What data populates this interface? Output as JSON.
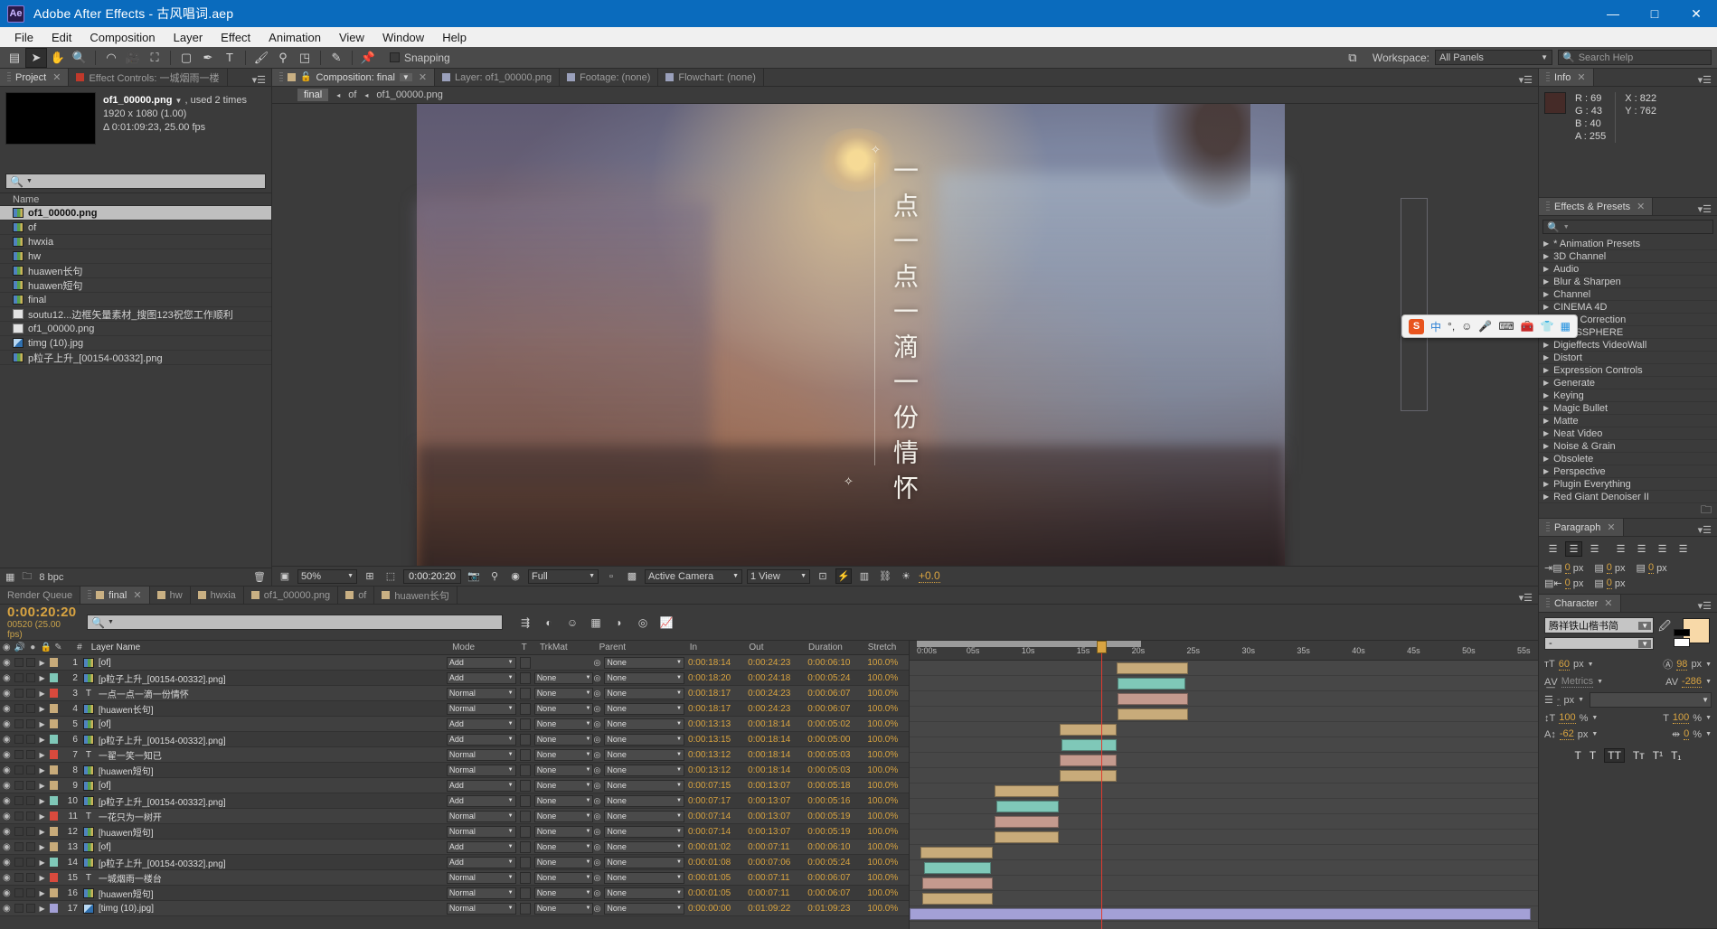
{
  "window": {
    "app_badge": "Ae",
    "title": "Adobe After Effects - 古风唱词.aep",
    "minimize": "—",
    "maximize": "□",
    "close": "✕"
  },
  "menu": [
    "File",
    "Edit",
    "Composition",
    "Layer",
    "Effect",
    "Animation",
    "View",
    "Window",
    "Help"
  ],
  "toolbar": {
    "snapping_label": "Snapping",
    "workspace_label": "Workspace:",
    "workspace_value": "All Panels",
    "search_help_placeholder": "Search Help",
    "tools": [
      "selection-tool",
      "hand-tool",
      "zoom-tool",
      "rotation-tool",
      "camera-tool",
      "pan-behind-tool",
      "shape-tool",
      "pen-tool",
      "type-tool",
      "brush-tool",
      "clone-stamp-tool",
      "eraser-tool",
      "roto-brush-tool",
      "puppet-pin-tool"
    ]
  },
  "project_panel": {
    "tabs": [
      {
        "label": "Project",
        "selected": true,
        "closable": true
      },
      {
        "label": "Effect Controls: 一城烟雨一楼",
        "selected": false,
        "closable": false
      }
    ],
    "preview": {
      "name": "of1_00000.png",
      "used": ", used 2 times",
      "dimensions": "1920 x 1080 (1.00)",
      "duration": "Δ 0:01:09:23, 25.00 fps"
    },
    "search_placeholder": "",
    "column_header": "Name",
    "items": [
      {
        "label": "of1_00000.png",
        "type": "comp",
        "selected": true
      },
      {
        "label": "of",
        "type": "comp",
        "selected": false
      },
      {
        "label": "hwxia",
        "type": "comp",
        "selected": false
      },
      {
        "label": "hw",
        "type": "comp",
        "selected": false
      },
      {
        "label": "huawen长句",
        "type": "comp",
        "selected": false
      },
      {
        "label": "huawen短句",
        "type": "comp",
        "selected": false
      },
      {
        "label": "final",
        "type": "comp",
        "selected": false
      },
      {
        "label": "soutu12...边框矢量素材_搜图123祝您工作顺利",
        "type": "doc",
        "selected": false
      },
      {
        "label": "of1_00000.png",
        "type": "doc",
        "selected": false
      },
      {
        "label": "timg (10).jpg",
        "type": "jpg",
        "selected": false
      },
      {
        "label": "p粒子上升_[00154-00332].png",
        "type": "seq",
        "selected": false
      }
    ],
    "footer_bpc": "8 bpc"
  },
  "composition_panel": {
    "tabs": [
      {
        "label": "Composition: final",
        "selected": true
      },
      {
        "label": "Layer: of1_00000.png",
        "selected": false
      },
      {
        "label": "Footage: (none)",
        "selected": false
      },
      {
        "label": "Flowchart: (none)",
        "selected": false
      }
    ],
    "breadcrumb": [
      "final",
      "of",
      "of1_00000.png"
    ],
    "canvas_text": "一点一点一滴一份情怀",
    "bottom_bar": {
      "zoom": "50%",
      "timecode": "0:00:20:20",
      "resolution": "Full",
      "view_mode": "Active Camera",
      "views": "1 View",
      "exposure": "+0.0"
    }
  },
  "timeline": {
    "tabs": [
      {
        "label": "Render Queue",
        "selected": false,
        "chip": false
      },
      {
        "label": "final",
        "selected": true,
        "chip": true
      },
      {
        "label": "hw",
        "selected": false,
        "chip": true
      },
      {
        "label": "hwxia",
        "selected": false,
        "chip": true
      },
      {
        "label": "of1_00000.png",
        "selected": false,
        "chip": true
      },
      {
        "label": "of",
        "selected": false,
        "chip": true
      },
      {
        "label": "huawen长句",
        "selected": false,
        "chip": true
      }
    ],
    "current_time": "0:00:20:20",
    "current_frame": "00520 (25.00 fps)",
    "search_placeholder": "",
    "columns": [
      "#",
      "Layer Name",
      "Mode",
      "T",
      "TrkMat",
      "Parent",
      "In",
      "Out",
      "Duration",
      "Stretch"
    ],
    "ruler_ticks": [
      "0:00s",
      "05s",
      "10s",
      "15s",
      "20s",
      "25s",
      "30s",
      "35s",
      "40s",
      "45s",
      "50s",
      "55s"
    ],
    "layers": [
      {
        "num": "1",
        "name": "[of]",
        "kind": "comp",
        "color": "#c8ab7a",
        "mode": "Add",
        "trkmat": "",
        "parent": "None",
        "in": "0:00:18:14",
        "out": "0:00:24:23",
        "duration": "0:00:06:10",
        "stretch": "100.0%",
        "bar_start": 0.332,
        "bar_width": 0.115,
        "bar_color": "#c8ab7a"
      },
      {
        "num": "2",
        "name": "[p粒子上升_[00154-00332].png]",
        "kind": "seq",
        "color": "#7fc8b8",
        "mode": "Add",
        "trkmat": "None",
        "parent": "None",
        "in": "0:00:18:20",
        "out": "0:00:24:18",
        "duration": "0:00:05:24",
        "stretch": "100.0%",
        "bar_start": 0.334,
        "bar_width": 0.108,
        "bar_color": "#7fc8b8"
      },
      {
        "num": "3",
        "name": "一点一点一滴一份情怀",
        "kind": "text",
        "color": "#d94a3d",
        "mode": "Normal",
        "trkmat": "None",
        "parent": "None",
        "in": "0:00:18:17",
        "out": "0:00:24:23",
        "duration": "0:00:06:07",
        "stretch": "100.0%",
        "bar_start": 0.333,
        "bar_width": 0.113,
        "bar_color": "#c49a8e"
      },
      {
        "num": "4",
        "name": "[huawen长句]",
        "kind": "comp",
        "color": "#c8ab7a",
        "mode": "Normal",
        "trkmat": "None",
        "parent": "None",
        "in": "0:00:18:17",
        "out": "0:00:24:23",
        "duration": "0:00:06:07",
        "stretch": "100.0%",
        "bar_start": 0.333,
        "bar_width": 0.113,
        "bar_color": "#c8ab7a"
      },
      {
        "num": "5",
        "name": "[of]",
        "kind": "comp",
        "color": "#c8ab7a",
        "mode": "Add",
        "trkmat": "None",
        "parent": "None",
        "in": "0:00:13:13",
        "out": "0:00:18:14",
        "duration": "0:00:05:02",
        "stretch": "100.0%",
        "bar_start": 0.24,
        "bar_width": 0.092,
        "bar_color": "#c8ab7a"
      },
      {
        "num": "6",
        "name": "[p粒子上升_[00154-00332].png]",
        "kind": "seq",
        "color": "#7fc8b8",
        "mode": "Add",
        "trkmat": "None",
        "parent": "None",
        "in": "0:00:13:15",
        "out": "0:00:18:14",
        "duration": "0:00:05:00",
        "stretch": "100.0%",
        "bar_start": 0.243,
        "bar_width": 0.089,
        "bar_color": "#7fc8b8"
      },
      {
        "num": "7",
        "name": "一翟一笑一知已",
        "kind": "text",
        "color": "#d94a3d",
        "mode": "Normal",
        "trkmat": "None",
        "parent": "None",
        "in": "0:00:13:12",
        "out": "0:00:18:14",
        "duration": "0:00:05:03",
        "stretch": "100.0%",
        "bar_start": 0.24,
        "bar_width": 0.092,
        "bar_color": "#c49a8e"
      },
      {
        "num": "8",
        "name": "[huawen短句]",
        "kind": "comp",
        "color": "#c8ab7a",
        "mode": "Normal",
        "trkmat": "None",
        "parent": "None",
        "in": "0:00:13:12",
        "out": "0:00:18:14",
        "duration": "0:00:05:03",
        "stretch": "100.0%",
        "bar_start": 0.24,
        "bar_width": 0.092,
        "bar_color": "#c8ab7a"
      },
      {
        "num": "9",
        "name": "[of]",
        "kind": "comp",
        "color": "#c8ab7a",
        "mode": "Add",
        "trkmat": "None",
        "parent": "None",
        "in": "0:00:07:15",
        "out": "0:00:13:07",
        "duration": "0:00:05:18",
        "stretch": "100.0%",
        "bar_start": 0.136,
        "bar_width": 0.103,
        "bar_color": "#c8ab7a"
      },
      {
        "num": "10",
        "name": "[p粒子上升_[00154-00332].png]",
        "kind": "seq",
        "color": "#7fc8b8",
        "mode": "Add",
        "trkmat": "None",
        "parent": "None",
        "in": "0:00:07:17",
        "out": "0:00:13:07",
        "duration": "0:00:05:16",
        "stretch": "100.0%",
        "bar_start": 0.139,
        "bar_width": 0.1,
        "bar_color": "#7fc8b8"
      },
      {
        "num": "11",
        "name": "一花只为一树开",
        "kind": "text",
        "color": "#d94a3d",
        "mode": "Normal",
        "trkmat": "None",
        "parent": "None",
        "in": "0:00:07:14",
        "out": "0:00:13:07",
        "duration": "0:00:05:19",
        "stretch": "100.0%",
        "bar_start": 0.136,
        "bar_width": 0.103,
        "bar_color": "#c49a8e"
      },
      {
        "num": "12",
        "name": "[huawen短句]",
        "kind": "comp",
        "color": "#c8ab7a",
        "mode": "Normal",
        "trkmat": "None",
        "parent": "None",
        "in": "0:00:07:14",
        "out": "0:00:13:07",
        "duration": "0:00:05:19",
        "stretch": "100.0%",
        "bar_start": 0.136,
        "bar_width": 0.103,
        "bar_color": "#c8ab7a"
      },
      {
        "num": "13",
        "name": "[of]",
        "kind": "comp",
        "color": "#c8ab7a",
        "mode": "Add",
        "trkmat": "None",
        "parent": "None",
        "in": "0:00:01:02",
        "out": "0:00:07:11",
        "duration": "0:00:06:10",
        "stretch": "100.0%",
        "bar_start": 0.018,
        "bar_width": 0.115,
        "bar_color": "#c8ab7a"
      },
      {
        "num": "14",
        "name": "[p粒子上升_[00154-00332].png]",
        "kind": "seq",
        "color": "#7fc8b8",
        "mode": "Add",
        "trkmat": "None",
        "parent": "None",
        "in": "0:00:01:08",
        "out": "0:00:07:06",
        "duration": "0:00:05:24",
        "stretch": "100.0%",
        "bar_start": 0.023,
        "bar_width": 0.108,
        "bar_color": "#7fc8b8"
      },
      {
        "num": "15",
        "name": "一城烟雨一楼台",
        "kind": "text",
        "color": "#d94a3d",
        "mode": "Normal",
        "trkmat": "None",
        "parent": "None",
        "in": "0:00:01:05",
        "out": "0:00:07:11",
        "duration": "0:00:06:07",
        "stretch": "100.0%",
        "bar_start": 0.021,
        "bar_width": 0.113,
        "bar_color": "#c49a8e"
      },
      {
        "num": "16",
        "name": "[huawen短句]",
        "kind": "comp",
        "color": "#c8ab7a",
        "mode": "Normal",
        "trkmat": "None",
        "parent": "None",
        "in": "0:00:01:05",
        "out": "0:00:07:11",
        "duration": "0:00:06:07",
        "stretch": "100.0%",
        "bar_start": 0.021,
        "bar_width": 0.113,
        "bar_color": "#c8ab7a"
      },
      {
        "num": "17",
        "name": "[timg (10).jpg]",
        "kind": "jpg",
        "color": "#a3a0d6",
        "mode": "Normal",
        "trkmat": "None",
        "parent": "None",
        "in": "0:00:00:00",
        "out": "0:01:09:22",
        "duration": "0:01:09:23",
        "stretch": "100.0%",
        "bar_start": 0.0,
        "bar_width": 0.995,
        "bar_color": "#a3a0d6"
      }
    ]
  },
  "info_panel": {
    "tab_label": "Info",
    "r_label": "R :",
    "r": "69",
    "g_label": "G :",
    "g": "43",
    "b_label": "B :",
    "b": "40",
    "a_label": "A :",
    "a": "255",
    "x_label": "X :",
    "x": "822",
    "y_label": "Y :",
    "y": "762"
  },
  "effects_panel": {
    "tab_label": "Effects & Presets",
    "search_placeholder": "",
    "items": [
      "* Animation Presets",
      "3D Channel",
      "Audio",
      "Blur & Sharpen",
      "Channel",
      "CINEMA 4D",
      "Color Correction",
      "CROSSPHERE",
      "Digieffects VideoWall",
      "Distort",
      "Expression Controls",
      "Generate",
      "Keying",
      "Magic Bullet",
      "Matte",
      "Neat Video",
      "Noise & Grain",
      "Obsolete",
      "Perspective",
      "Plugin Everything",
      "Red Giant Denoiser II"
    ]
  },
  "paragraph_panel": {
    "tab_label": "Paragraph",
    "indent_left": "0",
    "indent_right": "0",
    "indent_first": "0",
    "space_before": "0",
    "space_after": "0",
    "unit": "px",
    "align_selected_index": 1
  },
  "character_panel": {
    "tab_label": "Character",
    "font_family": "腾祥铁山楷书简",
    "font_style": "-",
    "font_size": "60",
    "leading": "98",
    "kerning": "Metrics",
    "tracking": "-286",
    "stroke_width": "-",
    "stroke_type": "",
    "vertical_scale": "100",
    "horizontal_scale": "100",
    "baseline_shift": "-62",
    "tsume": "0",
    "unit_px": "px",
    "unit_pct": "%",
    "styles": [
      "T",
      "T",
      "TT",
      "Tт",
      "T¹",
      "T₁"
    ],
    "style_selected_index": 2,
    "fill_color": "#f8d9a8"
  },
  "ime_bar": {
    "logo": "S",
    "mode": "中",
    "punct": "°,",
    "icons": [
      "smiley-icon",
      "mic-icon",
      "keyboard-icon",
      "toolbox-icon",
      "shirt-icon",
      "grid-icon"
    ]
  }
}
